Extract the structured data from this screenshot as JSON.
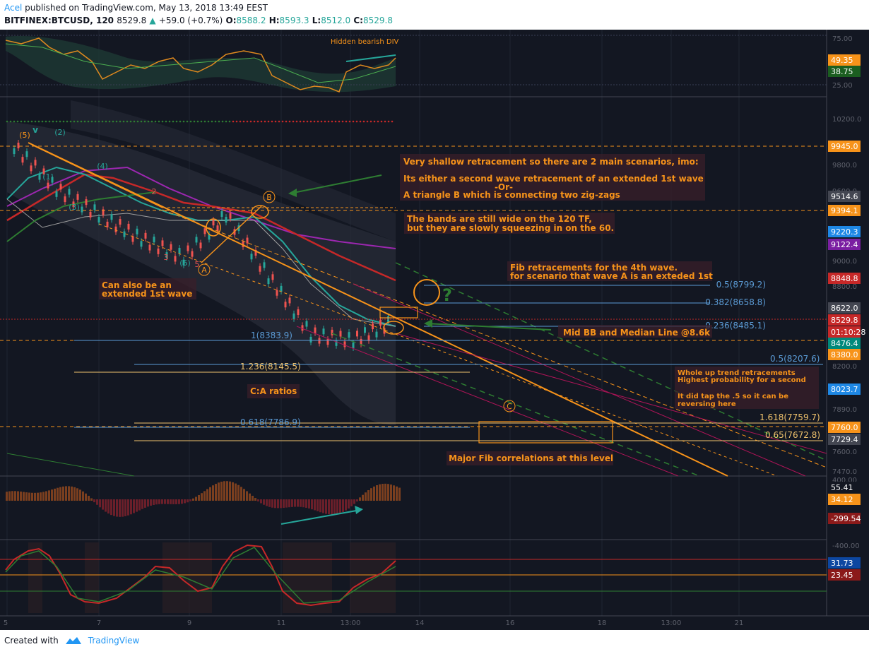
{
  "header": {
    "author": "Acel",
    "published": " published on TradingView.com, May 13, 2018 13:49 EEST",
    "symbol": "BITFINEX:BTCUSD, 120",
    "last": "8529.8",
    "change": "+59.0 (+0.7%)",
    "o_label": "O:",
    "o": "8588.2",
    "h_label": "H:",
    "h": "8593.3",
    "l_label": "L:",
    "l": "8512.0",
    "c_label": "C:",
    "c": "8529.8"
  },
  "footer": {
    "created_with": "Created with",
    "brand": "TradingView"
  },
  "colors": {
    "bg": "#131722",
    "accent": "#f7931a",
    "up": "#26a69a",
    "down": "#ef5350",
    "grid": "#1f2433"
  },
  "chart_data": {
    "type": "line",
    "title": "",
    "price_series": {
      "x": [
        "5",
        "6",
        "7",
        "8",
        "9",
        "10",
        "11",
        "12",
        "13:00",
        "13:30"
      ],
      "values": [
        9945.0,
        9600,
        9394.1,
        9200,
        9050,
        9394.1,
        8900,
        8430,
        8383.9,
        8529.8
      ]
    },
    "x_tick_labels": [
      "5",
      "7",
      "9",
      "11",
      "13:00",
      "14",
      "16",
      "18",
      "13:00",
      "21"
    ],
    "price_axis_ticks": [
      "10200.0",
      "9800.0",
      "9600.0",
      "9000.0",
      "8800.0",
      "8200.0",
      "7890.0",
      "7600.0",
      "7470.0"
    ],
    "price_labels": [
      {
        "text": "9945.0",
        "color": "#f7931a"
      },
      {
        "text": "9514.6",
        "color": "#434651"
      },
      {
        "text": "9394.1",
        "color": "#f7931a"
      },
      {
        "text": "9220.3",
        "color": "#1e88e5"
      },
      {
        "text": "9122.4",
        "color": "#7b1fa2"
      },
      {
        "text": "8848.8",
        "color": "#c62828"
      },
      {
        "text": "8622.0",
        "color": "#434651"
      },
      {
        "text": "8529.8",
        "color": "#c62828"
      },
      {
        "text": "01:10:28",
        "color": "#c62828"
      },
      {
        "text": "8476.4",
        "color": "#00897b"
      },
      {
        "text": "8380.0",
        "color": "#f7931a"
      },
      {
        "text": "8023.7",
        "color": "#1e88e5"
      },
      {
        "text": "7760.0",
        "color": "#f7931a"
      },
      {
        "text": "7729.4",
        "color": "#434651"
      }
    ],
    "fib_levels": [
      {
        "label": "0.5(8799.2)",
        "color": "#5b9bd5"
      },
      {
        "label": "0.382(8658.8)",
        "color": "#5b9bd5"
      },
      {
        "label": "0.236(8485.1)",
        "color": "#5b9bd5"
      },
      {
        "label": "1(8383.9)",
        "color": "#5b9bd5"
      },
      {
        "label": "0.5(8207.6)",
        "color": "#5b9bd5"
      },
      {
        "label": "1.236(8145.5)",
        "color": "#f0c36d"
      },
      {
        "label": "1.618(7759.7)",
        "color": "#f0c36d"
      },
      {
        "label": "0.618(7786.9)",
        "color": "#5b9bd5"
      },
      {
        "label": "0.65(7672.8)",
        "color": "#f0c36d"
      }
    ],
    "wave_labels": [
      "(5)",
      "(2)",
      "(1)",
      "(4)",
      "(3)",
      "2",
      "3",
      "(5)",
      "5",
      "A",
      "B",
      "C"
    ],
    "annotations": {
      "hidden_div": "Hidden bearish DIV",
      "scenarios_1": "Very shallow retracement so there are 2 main scenarios, imo:",
      "scenarios_2": "Its either a second wave retracement of an extended 1st wave",
      "scenarios_3": "-Or-",
      "scenarios_4": "A triangle B which is connecting two zig-zags",
      "bands_1": "The bands are still wide on the 120 TF,",
      "bands_2": "but they are slowly squeezing in on the 60.",
      "fib_1": "Fib retracements for the 4th wave.",
      "fib_2": "for scenario that wave A is an exteded 1st",
      "extended_1": "Can also be an",
      "extended_2": "extended 1st wave",
      "midbb": "Mid BB and Median Line @8.6k",
      "whole_1": "Whole up trend retracements",
      "whole_2": "Highest probability for a second",
      "whole_3": "It did tap the .5 so it can be",
      "whole_4": "reversing here",
      "ca_ratios": "C:A ratios",
      "major": "Major Fib correlations at this level",
      "question": "?",
      "v_mark": "v"
    },
    "rsi": {
      "ticks": [
        "75.00",
        "25.00"
      ],
      "labels": [
        {
          "text": "49.35",
          "color": "#f7931a"
        },
        {
          "text": "38.75",
          "color": "#1b5e20"
        }
      ]
    },
    "macd": {
      "ticks": [
        "400.00",
        "-400.00"
      ],
      "labels": [
        {
          "text": "55.41",
          "color": "#131722"
        },
        {
          "text": "34.12",
          "color": "#f7931a"
        },
        {
          "text": "-299.54",
          "color": "#8b1a1a"
        }
      ]
    },
    "stoch": {
      "labels": [
        {
          "text": "31.73",
          "color": "#0d47a1"
        },
        {
          "text": "23.45",
          "color": "#8b1a1a"
        }
      ]
    }
  }
}
